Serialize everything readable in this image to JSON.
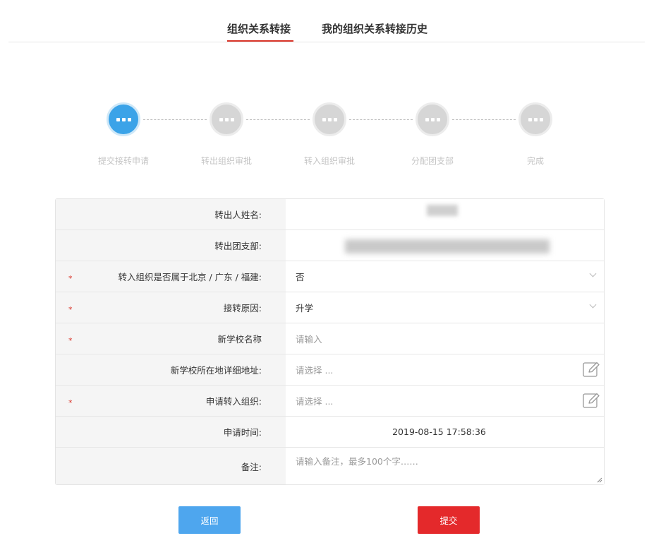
{
  "tabs": [
    {
      "label": "组织关系转接",
      "active": true
    },
    {
      "label": "我的组织关系转接历史",
      "active": false
    }
  ],
  "steps": [
    {
      "label": "提交接转申请",
      "status": "active"
    },
    {
      "label": "转出组织审批",
      "status": "pending"
    },
    {
      "label": "转入组织审批",
      "status": "pending"
    },
    {
      "label": "分配团支部",
      "status": "pending"
    },
    {
      "label": "完成",
      "status": "pending"
    }
  ],
  "form": {
    "required_mark": "*",
    "fields": [
      {
        "label": "转出人姓名:",
        "required": false,
        "value": ""
      },
      {
        "label": "转出团支部:",
        "required": false,
        "value": ""
      },
      {
        "label": "转入组织是否属于北京 / 广东 / 福建:",
        "required": true,
        "value": "否"
      },
      {
        "label": "接转原因:",
        "required": true,
        "value": "升学"
      },
      {
        "label": "新学校名称",
        "required": true,
        "placeholder": "请输入"
      },
      {
        "label": "新学校所在地详细地址:",
        "required": false,
        "placeholder": "请选择 ..."
      },
      {
        "label": "申请转入组织:",
        "required": true,
        "placeholder": "请选择 ..."
      },
      {
        "label": "申请时间:",
        "required": false,
        "value": "2019-08-15 17:58:36"
      },
      {
        "label": "备注:",
        "required": false,
        "placeholder": "请输入备注，最多100个字……"
      }
    ]
  },
  "buttons": {
    "back": "返回",
    "submit": "提交"
  },
  "colors": {
    "accent_red": "#d9352a",
    "step_active": "#3ba3e8",
    "back_button": "#4ea6ee",
    "submit_button": "#e4292b"
  },
  "icons": {
    "step": "ellipsis-icon",
    "select": "chevron-down-icon",
    "picker": "edit-icon"
  }
}
